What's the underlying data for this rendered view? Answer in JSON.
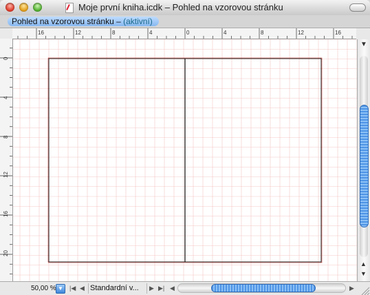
{
  "window": {
    "title": "Moje první kniha.icdk – Pohled na vzorovou stránku"
  },
  "tab": {
    "label": "Pohled na vzorovou stránku – ",
    "status": "(aktivní)"
  },
  "ruler_h": {
    "labels": [
      "16",
      "12",
      "8",
      "4",
      "0",
      "4",
      "8",
      "12",
      "16"
    ]
  },
  "ruler_v": {
    "labels": [
      "0",
      "4",
      "8",
      "12",
      "16",
      "20"
    ]
  },
  "statusbar": {
    "zoom": "50,00 %",
    "page_field": "Standardní v..."
  },
  "icons": {
    "first_page": "first-page-icon",
    "prev_page": "prev-page-icon",
    "next_page": "next-page-icon",
    "last_page": "last-page-icon",
    "scroll_left": "arrow-left-icon",
    "scroll_right": "arrow-right-icon",
    "scroll_up": "arrow-up-icon",
    "scroll_down": "arrow-down-icon"
  },
  "colors": {
    "selection_blue": "#4f95e6",
    "grid_pink": "#f6c7c7",
    "page_border_red": "#c0271f"
  }
}
